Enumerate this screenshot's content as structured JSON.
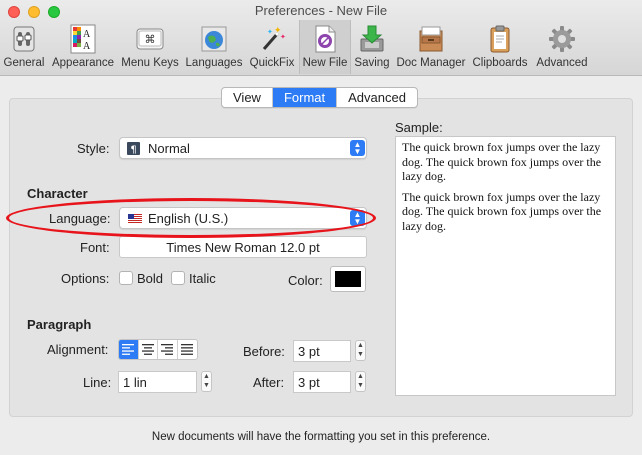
{
  "window": {
    "title": "Preferences - New File"
  },
  "toolbar": {
    "items": [
      {
        "label": "General",
        "icon": "switch-icon"
      },
      {
        "label": "Appearance",
        "icon": "font-palette-icon"
      },
      {
        "label": "Menu Keys",
        "icon": "command-key-icon"
      },
      {
        "label": "Languages",
        "icon": "globe-flag-icon"
      },
      {
        "label": "QuickFix",
        "icon": "magic-wand-icon"
      },
      {
        "label": "New File",
        "icon": "new-file-icon",
        "selected": true
      },
      {
        "label": "Saving",
        "icon": "save-arrow-icon"
      },
      {
        "label": "Doc Manager",
        "icon": "drawer-icon"
      },
      {
        "label": "Clipboards",
        "icon": "clipboard-icon"
      },
      {
        "label": "Advanced",
        "icon": "gear-icon"
      }
    ]
  },
  "tabs": {
    "view": "View",
    "format": "Format",
    "advanced": "Advanced",
    "selected": "Format"
  },
  "style": {
    "label": "Style:",
    "value": "Normal"
  },
  "character": {
    "heading": "Character",
    "language_label": "Language:",
    "language_value": "English (U.S.)",
    "font_label": "Font:",
    "font_value": "Times New Roman 12.0 pt",
    "options_label": "Options:",
    "bold_label": "Bold",
    "italic_label": "Italic",
    "bold_checked": false,
    "italic_checked": false,
    "color_label": "Color:",
    "color_value": "#000000"
  },
  "paragraph": {
    "heading": "Paragraph",
    "alignment_label": "Alignment:",
    "alignment_selected": "left",
    "before_label": "Before:",
    "before_value": "3 pt",
    "line_label": "Line:",
    "line_value": "1 lin",
    "after_label": "After:",
    "after_value": "3 pt"
  },
  "sample": {
    "label": "Sample:",
    "paragraphs": [
      "The quick brown fox jumps over the lazy dog. The quick brown fox jumps over the lazy dog.",
      "The quick brown fox jumps over the lazy dog. The quick brown fox jumps over the lazy dog."
    ]
  },
  "footer": "New documents will have the formatting you set in this preference.",
  "colors": {
    "accent": "#2d7cf6",
    "annotation": "#e8141b"
  }
}
